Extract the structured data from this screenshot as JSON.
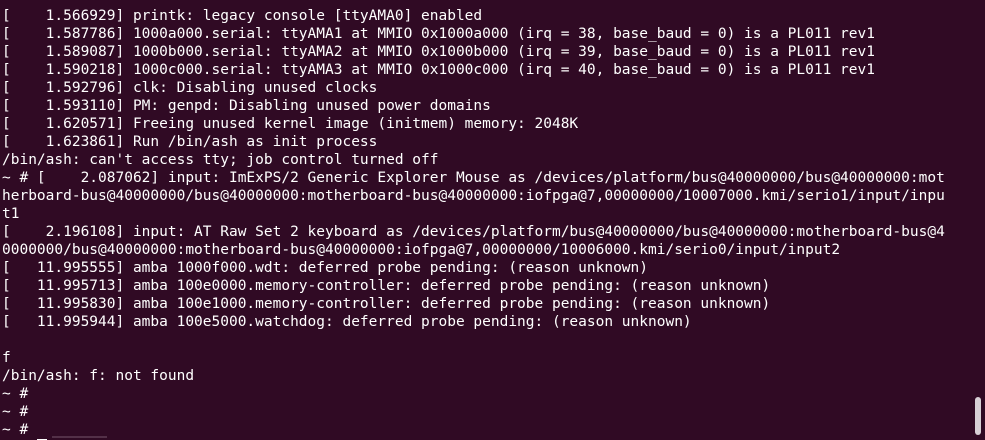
{
  "terminal": {
    "colors": {
      "background": "#300a24",
      "foreground": "#ffffff",
      "scrollbar_thumb": "#d8d0d6"
    },
    "lines": [
      "[    1.566929] printk: legacy console [ttyAMA0] enabled",
      "[    1.587786] 1000a000.serial: ttyAMA1 at MMIO 0x1000a000 (irq = 38, base_baud = 0) is a PL011 rev1",
      "[    1.589087] 1000b000.serial: ttyAMA2 at MMIO 0x1000b000 (irq = 39, base_baud = 0) is a PL011 rev1",
      "[    1.590218] 1000c000.serial: ttyAMA3 at MMIO 0x1000c000 (irq = 40, base_baud = 0) is a PL011 rev1",
      "[    1.592796] clk: Disabling unused clocks",
      "[    1.593110] PM: genpd: Disabling unused power domains",
      "[    1.620571] Freeing unused kernel image (initmem) memory: 2048K",
      "[    1.623861] Run /bin/ash as init process",
      "/bin/ash: can't access tty; job control turned off",
      "~ # [    2.087062] input: ImExPS/2 Generic Explorer Mouse as /devices/platform/bus@40000000/bus@40000000:mot",
      "herboard-bus@40000000/bus@40000000:motherboard-bus@40000000:iofpga@7,00000000/10007000.kmi/serio1/input/inpu",
      "t1",
      "[    2.196108] input: AT Raw Set 2 keyboard as /devices/platform/bus@40000000/bus@40000000:motherboard-bus@4",
      "0000000/bus@40000000:motherboard-bus@40000000:iofpga@7,00000000/10006000.kmi/serio0/input/input2",
      "[   11.995555] amba 1000f000.wdt: deferred probe pending: (reason unknown)",
      "[   11.995713] amba 100e0000.memory-controller: deferred probe pending: (reason unknown)",
      "[   11.995830] amba 100e1000.memory-controller: deferred probe pending: (reason unknown)",
      "[   11.995944] amba 100e5000.watchdog: deferred probe pending: (reason unknown)",
      "",
      "f",
      "/bin/ash: f: not found",
      "~ #",
      "~ #",
      "~ #"
    ],
    "prompt": "~ # "
  }
}
